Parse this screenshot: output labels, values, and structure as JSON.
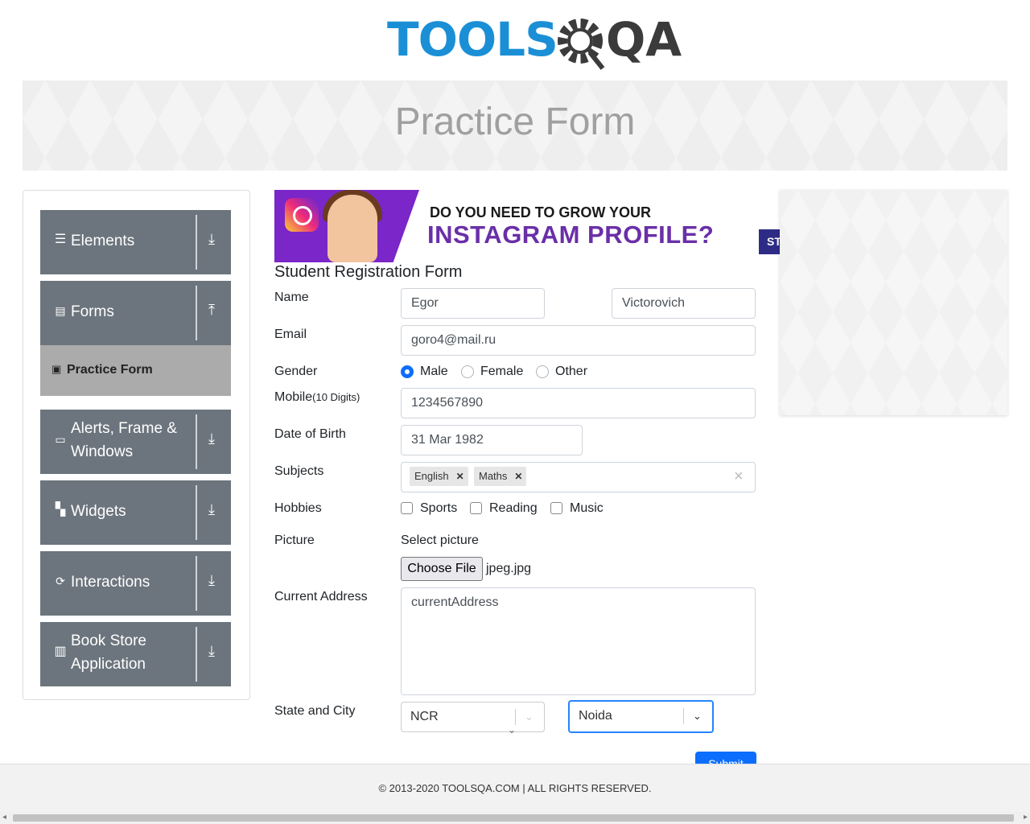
{
  "header": {
    "logo_part1": "TOOLS",
    "logo_part2": "QA"
  },
  "banner": {
    "title": "Practice Form"
  },
  "sidebar": {
    "groups": [
      {
        "label": "Elements",
        "icon": "list-icon",
        "arrow": "⤓"
      },
      {
        "label": "Forms",
        "icon": "document-icon",
        "arrow": "⤒"
      },
      {
        "label": "Alerts, Frame & Windows",
        "icon": "window-icon",
        "arrow": "⤓"
      },
      {
        "label": "Widgets",
        "icon": "widgets-icon",
        "arrow": "⤓"
      },
      {
        "label": "Interactions",
        "icon": "interactions-icon",
        "arrow": "⤓"
      },
      {
        "label": "Book Store Application",
        "icon": "books-icon",
        "arrow": "⤓"
      }
    ],
    "active_item": "Practice Form"
  },
  "ad": {
    "line1": "DO YOU NEED TO GROW YOUR",
    "line2": "INSTAGRAM PROFILE?",
    "side_button": "ST"
  },
  "form": {
    "title": "Student Registration Form",
    "name_label": "Name",
    "first_name": "Egor",
    "last_name": "Victorovich",
    "email_label": "Email",
    "email": "goro4@mail.ru",
    "gender_label": "Gender",
    "gender_options": [
      "Male",
      "Female",
      "Other"
    ],
    "gender_selected": "Male",
    "mobile_label": "Mobile",
    "mobile_hint": "(10 Digits)",
    "mobile": "1234567890",
    "dob_label": "Date of Birth",
    "dob": "31 Mar 1982",
    "subjects_label": "Subjects",
    "subjects": [
      "English",
      "Maths"
    ],
    "subjects_clear": "×",
    "hobbies_label": "Hobbies",
    "hobbies": [
      "Sports",
      "Reading",
      "Music"
    ],
    "picture_label": "Picture",
    "select_picture": "Select picture",
    "choose_file": "Choose File",
    "file_name": "jpeg.jpg",
    "address_label": "Current Address",
    "address_placeholder": "currentAddress",
    "state_city_label": "State and City",
    "state": "NCR",
    "city": "Noida",
    "submit": "Submit"
  },
  "footer": {
    "text": "© 2013-2020 TOOLSQA.COM | ALL RIGHTS RESERVED."
  },
  "colors": {
    "accent": "#0d6efd",
    "sidebar_group": "#6c757d",
    "active_item": "#ababab",
    "logo_blue": "#1b8fd6"
  }
}
